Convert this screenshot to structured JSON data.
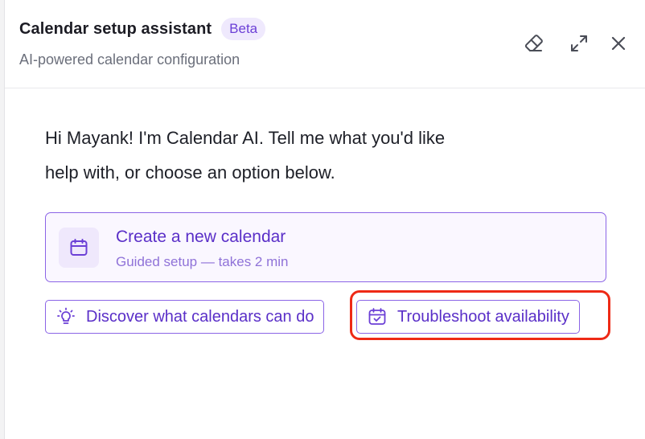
{
  "header": {
    "title": "Calendar setup assistant",
    "badge": "Beta",
    "subtitle": "AI-powered calendar configuration",
    "actions": [
      {
        "name": "clear-chat",
        "icon": "eraser-icon"
      },
      {
        "name": "expand",
        "icon": "expand-icon"
      },
      {
        "name": "close",
        "icon": "close-icon"
      }
    ]
  },
  "main": {
    "greeting_line1": "Hi Mayank! I'm Calendar AI. Tell me what you'd like",
    "greeting_line2": "help with, or choose an option below.",
    "primary_option": {
      "title": "Create a new calendar",
      "subtitle": "Guided setup — takes 2 min",
      "icon": "calendar-icon"
    },
    "secondary_options": [
      {
        "label": "Discover what calendars can do",
        "icon": "lightbulb-icon"
      },
      {
        "label": "Troubleshoot availability",
        "icon": "calendar-check-icon"
      }
    ]
  },
  "colors": {
    "accent": "#6b3fd6",
    "highlight": "#ee2a16"
  }
}
